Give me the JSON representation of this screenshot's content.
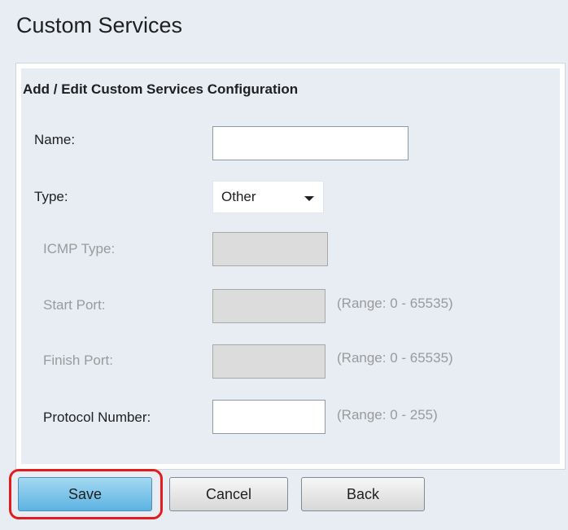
{
  "page": {
    "title": "Custom Services"
  },
  "panel": {
    "header": "Add / Edit Custom Services Configuration"
  },
  "form": {
    "name": {
      "label": "Name:",
      "value": ""
    },
    "type": {
      "label": "Type:",
      "selected": "Other"
    },
    "icmp_type": {
      "label": "ICMP Type:",
      "value": ""
    },
    "start_port": {
      "label": "Start Port:",
      "value": "",
      "range": "(Range: 0 - 65535)"
    },
    "finish_port": {
      "label": "Finish Port:",
      "value": "",
      "range": "(Range: 0 - 65535)"
    },
    "protocol_number": {
      "label": "Protocol Number:",
      "value": "",
      "range": "(Range: 0 - 255)"
    }
  },
  "buttons": {
    "save": "Save",
    "cancel": "Cancel",
    "back": "Back"
  },
  "colors": {
    "background": "#e8edf4",
    "primary_button": "#5cb3e2",
    "highlight": "#e21c1c"
  }
}
